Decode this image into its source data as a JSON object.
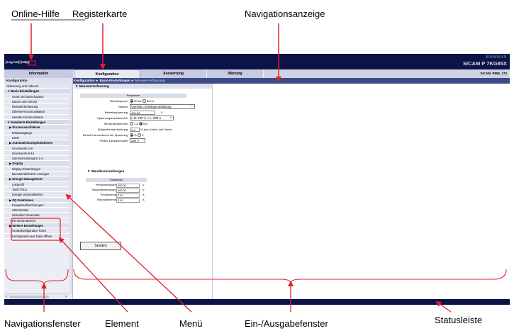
{
  "annotations": {
    "online_help": "Online-Hilfe",
    "tab_label": "Registerkarte",
    "nav_display": "Navigationsanzeige",
    "nav_window": "Navigationsfenster",
    "element": "Element",
    "menu": "Menü",
    "io_window": "Ein-/Ausgabefenster",
    "status_bar": "Statusleiste"
  },
  "header": {
    "help_links": "[Log out] [Help]",
    "brand": "SIEMENS",
    "product": "SICAM P 7KG85X",
    "device_id": "SICAM_P855_173"
  },
  "tabs": [
    {
      "label": "Information"
    },
    {
      "label": "Konfiguration"
    },
    {
      "label": "Auswertung"
    },
    {
      "label": "Wartung"
    }
  ],
  "breadcrumb": {
    "part1": "Konfiguration",
    "part2": "Basis-Einstellungen",
    "part3": "Messwerterfassung"
  },
  "nav": {
    "title": "Konfiguration",
    "items": [
      "Aktivierung und Abbruch",
      "▼ Basis-Einstellungen",
      "Gerät und Sprachoption",
      "Datum und Uhrzeit",
      "Messwerterfassung",
      "Ethernet-Kommunikation",
      "Serielle Kommunikation",
      "▼ Erweiterte Einstellungen",
      "▶ Prozessanschlüsse",
      "Binärausgänge",
      "LEDs",
      "▶ Automatisierungsfunktionen",
      "Grenzwerte 1-8",
      "Grenzwerte 9-16",
      "Sammelmeldungen 1-4",
      "▶ Display",
      "Display-Einstellungen",
      "Benutzerdefinierte Anzeigen",
      "▶ Energie-Management",
      "Lastprofil",
      "Tarif (TOU)",
      "Energie (Intervallwerte)",
      "▶ PQ Funktionen",
      "Ereignisaufzeichnungen",
      "Störschriebe",
      "Schreiber-Parameter",
      "EN 50160 Bericht",
      "▶ Weitere Einstellungen",
      "Gerätekonfiguration holen",
      "Konfiguration aus Datei öffnen"
    ]
  },
  "form": {
    "section1": "▼ Messwerterfassung",
    "param_header": "Parameter",
    "rows": [
      {
        "label": "Nennfrequenz",
        "opt1": "50 Hz",
        "opt2": "60 Hz"
      },
      {
        "label": "Netzart",
        "value": "Vierleiter, beliebige Belastung"
      },
      {
        "label": "Betriebsspannung",
        "value": "400.00",
        "unit": "V"
      },
      {
        "label": "Spannungsmessbereich",
        "value": "L-N: 400 V, L-L: 690 V"
      },
      {
        "label": "Strommessbereich",
        "opt1": "1 A",
        "opt2": "5 A"
      },
      {
        "label": "Nullpunktunterdrückung",
        "value": "0.3",
        "unit": "% (von Urenn und Inenn)"
      },
      {
        "label": "Einheit Harmonische der Spannung",
        "opt1": "%",
        "opt2": "V"
      },
      {
        "label": "Flicker-Lampenmodell",
        "value": "230 V"
      }
    ],
    "section2": "▼ Wandlereinstellungen",
    "param_header2": "Parameter",
    "rows2": [
      {
        "label": "Primärnennspannung",
        "value": "400.00",
        "unit": "V"
      },
      {
        "label": "Sekundärnennspannung",
        "value": "400.00",
        "unit": "V"
      },
      {
        "label": "Primärnennstrom",
        "value": "5.00",
        "unit": "A"
      },
      {
        "label": "Sekundärnennstrom",
        "value": "5.00",
        "unit": "A"
      }
    ],
    "send_button": "Senden"
  },
  "colors": {
    "header_bg": "#0c1346",
    "annotation_red": "#e0202a"
  }
}
